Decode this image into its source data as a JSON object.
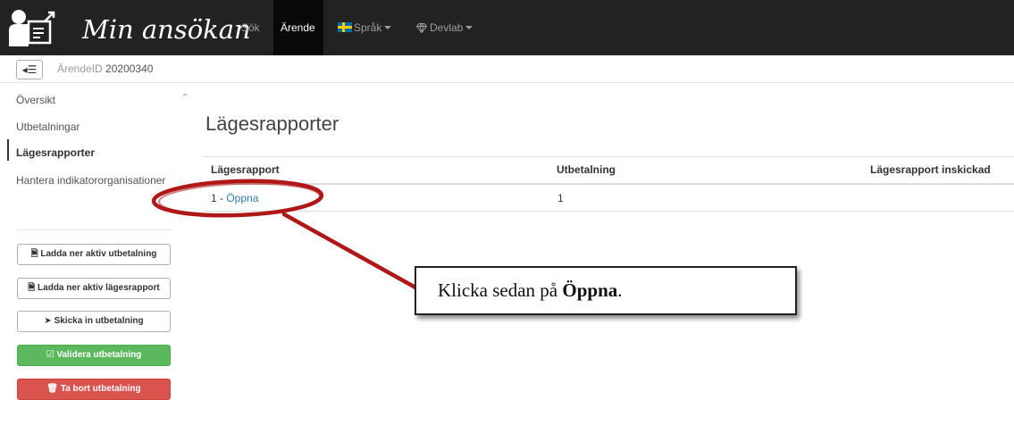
{
  "brand": {
    "title": "Min ansökan",
    "icon": "user-form-icon"
  },
  "nav": {
    "sok": "Sök",
    "arende": "Ärende",
    "sprak": "Språk",
    "devlab": "Devlab"
  },
  "subheader": {
    "toggle_icon": "◂☰",
    "case_label": "ÄrendeID",
    "case_id": "20200340"
  },
  "sidebar": {
    "items": [
      {
        "label": "Översikt"
      },
      {
        "label": "Utbetalningar"
      },
      {
        "label": "Lägesrapporter",
        "active": true
      },
      {
        "label": "Hantera indikatororganisationer"
      }
    ],
    "buttons": [
      {
        "label": "Ladda ner aktiv utbetalning",
        "icon": "file-pdf-icon"
      },
      {
        "label": "Ladda ner aktiv lägesrapport",
        "icon": "file-pdf-icon"
      },
      {
        "label": "Skicka in utbetalning",
        "icon": "send-icon"
      },
      {
        "label": "Validera utbetalning",
        "icon": "check-square-icon",
        "color": "#5cb85c"
      },
      {
        "label": "Ta bort utbetalning",
        "icon": "trash-icon",
        "color": "#d9534f"
      }
    ]
  },
  "main": {
    "title": "Lägesrapporter",
    "table": {
      "headers": [
        "Lägesrapport",
        "Utbetalning",
        "Lägesrapport inskickad"
      ],
      "rows": [
        {
          "prefix": "1 - ",
          "link": "Öppna",
          "utbetalning": "1",
          "inskickad": ""
        }
      ]
    }
  },
  "annotation": {
    "text_before": "Klicka sedan på ",
    "text_bold": "Öppna",
    "text_after": ".",
    "color": "#b01818"
  }
}
